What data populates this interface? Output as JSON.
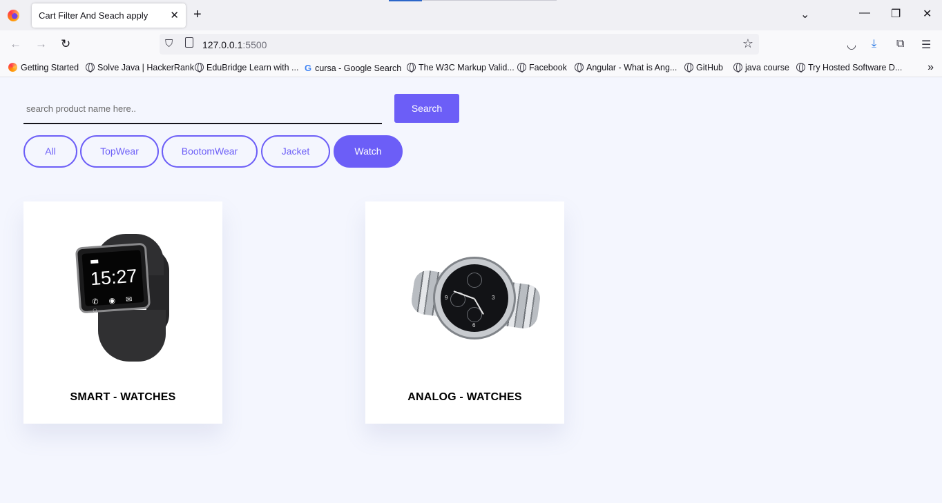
{
  "browser": {
    "tab_title": "Cart Filter And Seach apply",
    "url_host": "127.0.0.1",
    "url_port": ":5500",
    "bookmarks": [
      {
        "label": "Getting Started",
        "icon": "firefox-icon"
      },
      {
        "label": "Solve Java | HackerRank",
        "icon": "globe-icon"
      },
      {
        "label": "EduBridge Learn with ...",
        "icon": "globe-icon"
      },
      {
        "label": "cursa - Google Search",
        "icon": "google-icon"
      },
      {
        "label": "The W3C Markup Valid...",
        "icon": "globe-icon"
      },
      {
        "label": "Facebook",
        "icon": "globe-icon"
      },
      {
        "label": "Angular - What is Ang...",
        "icon": "globe-icon"
      },
      {
        "label": "GitHub",
        "icon": "globe-icon"
      },
      {
        "label": "java course",
        "icon": "globe-icon"
      },
      {
        "label": "Try Hosted Software D...",
        "icon": "globe-icon"
      }
    ]
  },
  "search": {
    "placeholder": "search product name here..",
    "value": "",
    "button_label": "Search"
  },
  "filters": [
    {
      "label": "All",
      "active": false
    },
    {
      "label": "TopWear",
      "active": false
    },
    {
      "label": "BootomWear",
      "active": false
    },
    {
      "label": "Jacket",
      "active": false
    },
    {
      "label": "Watch",
      "active": true
    }
  ],
  "products": [
    {
      "title": "SMART - WATCHES",
      "image": "smartwatch-image",
      "watch_time": "15:27"
    },
    {
      "title": "ANALOG - WATCHES",
      "image": "analog-watch-image"
    }
  ],
  "colors": {
    "accent": "#6c5ef7",
    "page_bg": "#f4f6fe",
    "card_bg": "#ffffff"
  }
}
